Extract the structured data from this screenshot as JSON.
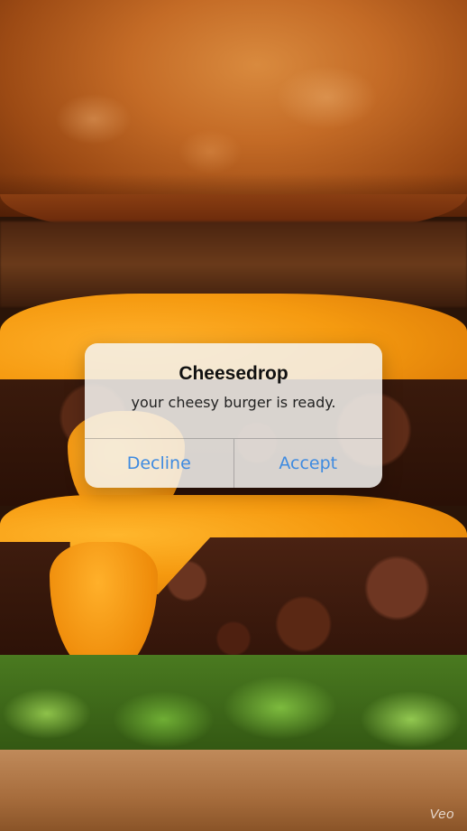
{
  "alert": {
    "title": "Cheesedrop",
    "message": "your cheesy burger is ready.",
    "decline_label": "Decline",
    "accept_label": "Accept"
  },
  "background": {
    "description_icon": "burger-photo"
  },
  "watermark": "Veo",
  "colors": {
    "button_text": "#3f8be0",
    "alert_background": "#f5f3f0"
  }
}
